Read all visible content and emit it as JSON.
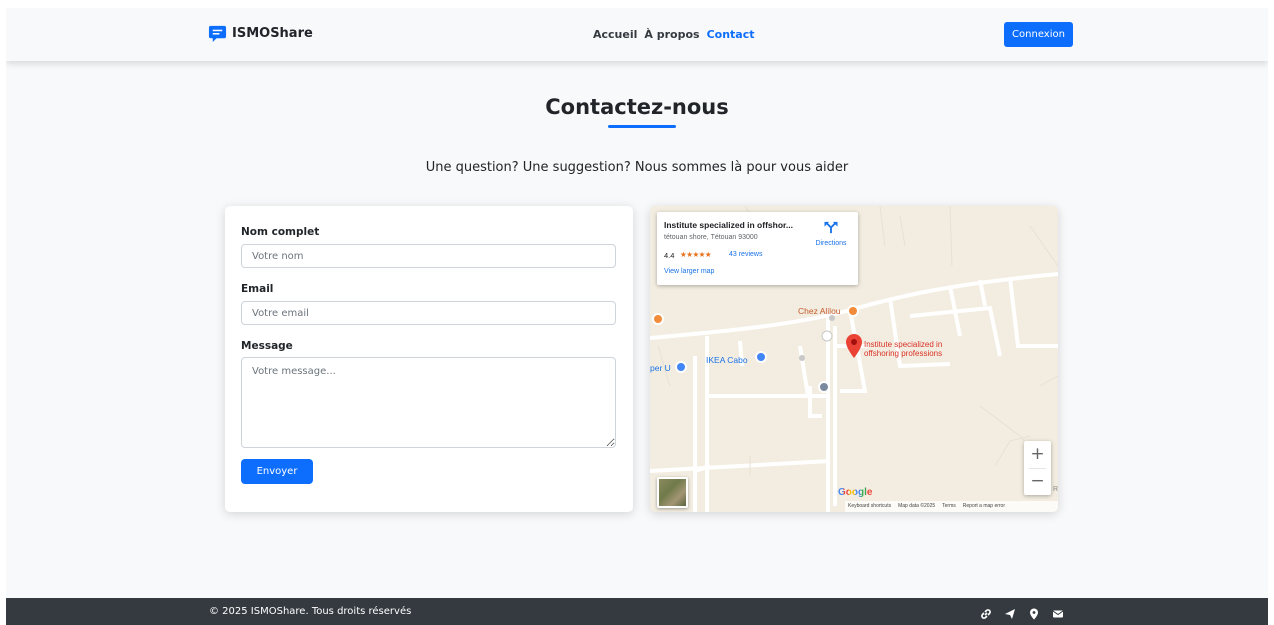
{
  "header": {
    "brand": "ISMOShare",
    "nav": [
      {
        "label": "Accueil",
        "active": false
      },
      {
        "label": "À propos",
        "active": false
      },
      {
        "label": "Contact",
        "active": true
      }
    ],
    "login_label": "Connexion"
  },
  "hero": {
    "title": "Contactez-nous",
    "subtitle": "Une question? Une suggestion? Nous sommes là pour vous aider"
  },
  "form": {
    "name_label": "Nom complet",
    "name_placeholder": "Votre nom",
    "email_label": "Email",
    "email_placeholder": "Votre email",
    "message_label": "Message",
    "message_placeholder": "Votre message...",
    "submit_label": "Envoyer"
  },
  "map": {
    "place_name": "Institute specialized in offshor...",
    "address": "tétouan shore, Tétouan 93000",
    "rating": "4.4",
    "stars": "★★★★★",
    "reviews": "43 reviews",
    "larger_map": "View larger map",
    "directions": "Directions",
    "labels": {
      "restaurant": "Chez Alilou",
      "store": "IKEA Cabo",
      "partial_store": "per U",
      "pin_line1": "Institute specialized in",
      "pin_line2": "offshoring professions",
      "corner": "R"
    },
    "zoom_in": "+",
    "zoom_out": "−",
    "google": "Google",
    "attribution": [
      "Keyboard shortcuts",
      "Map data ©2025",
      "Terms",
      "Report a map error"
    ]
  },
  "footer": {
    "copyright": "© 2025 ISMOShare. Tous droits réservés",
    "icons": [
      "link-icon",
      "send-icon",
      "location-icon",
      "mail-icon"
    ]
  },
  "colors": {
    "primary": "#0d6efd",
    "footer_bg": "#343a40",
    "map_bg": "#f3ede1",
    "pin": "#ea4335"
  }
}
